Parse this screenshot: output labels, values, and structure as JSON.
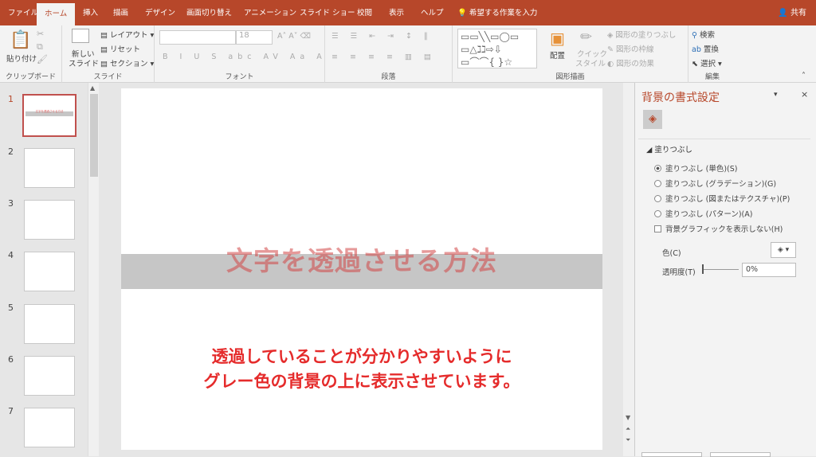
{
  "tabs": [
    "ファイル",
    "ホーム",
    "挿入",
    "描画",
    "デザイン",
    "画面切り替え",
    "アニメーション",
    "スライド ショー",
    "校閲",
    "表示",
    "ヘルプ"
  ],
  "tell_me": "希望する作業を入力",
  "share": "共有",
  "ribbon": {
    "paste": "貼り付け",
    "clipboard": "クリップボード",
    "new_slide_1": "新しい",
    "new_slide_2": "スライド",
    "layout": "レイアウト",
    "reset": "リセット",
    "section": "セクション",
    "slides_group": "スライド",
    "font_size": "18",
    "font_group": "フォント",
    "paragraph_group": "段落",
    "arrange": "配置",
    "quick_style_1": "クイック",
    "quick_style_2": "スタイル",
    "shape_fill": "図形の塗りつぶし",
    "shape_outline": "図形の枠線",
    "shape_effects": "図形の効果",
    "drawing_group": "図形描画",
    "find": "検索",
    "replace": "置換",
    "select": "選択",
    "editing_group": "編集"
  },
  "slide_numbers": [
    "1",
    "2",
    "3",
    "4",
    "5",
    "6",
    "7"
  ],
  "thumb_caption": "文字を透過させる方法",
  "slide": {
    "title": "文字を透過させる方法",
    "note_line1": "透過していることが分かりやすいように",
    "note_line2": "グレー色の背景の上に表示させています。"
  },
  "pane": {
    "title": "背景の書式設定",
    "section": "塗りつぶし",
    "options": [
      "塗りつぶし (単色)(S)",
      "塗りつぶし (グラデーション)(G)",
      "塗りつぶし (図またはテクスチャ)(P)",
      "塗りつぶし (パターン)(A)"
    ],
    "hide_graphics": "背景グラフィックを表示しない(H)",
    "color_label": "色(C)",
    "transparency_label": "透明度(T)",
    "transparency_value": "0%"
  },
  "colors": {
    "accent": "#b7472a",
    "note": "#e52b2b",
    "band": "#c6c6c6"
  }
}
